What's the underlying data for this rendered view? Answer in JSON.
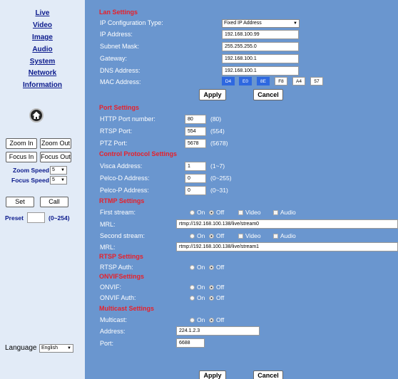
{
  "nav": {
    "live": "Live",
    "video": "Video",
    "image": "Image",
    "audio": "Audio",
    "system": "System",
    "network": "Network",
    "information": "Information"
  },
  "ptz": {
    "zoom_in": "Zoom In",
    "zoom_out": "Zoom Out",
    "focus_in": "Focus In",
    "focus_out": "Focus Out",
    "zoom_speed_label": "Zoom Speed",
    "zoom_speed_value": "5",
    "focus_speed_label": "Focus Speed",
    "focus_speed_value": "5",
    "set": "Set",
    "call": "Call",
    "preset_label": "Preset",
    "preset_value": "",
    "preset_range": "(0~254)"
  },
  "language": {
    "label": "Language",
    "value": "English"
  },
  "lan": {
    "title": "Lan Settings",
    "ip_type_label": "IP Configuration Type:",
    "ip_type_value": "Fixed IP Address",
    "ip_label": "IP Address:",
    "ip_value": "192.168.100.99",
    "subnet_label": "Subnet Mask:",
    "subnet_value": "255.255.255.0",
    "gateway_label": "Gateway:",
    "gateway_value": "192.168.100.1",
    "dns_label": "DNS Address:",
    "dns_value": "192.168.100.1",
    "mac_label": "MAC Address:",
    "mac": [
      "D4",
      "E0",
      "8E",
      "F8",
      "A4",
      "57"
    ]
  },
  "buttons": {
    "apply": "Apply",
    "cancel": "Cancel"
  },
  "port": {
    "title": "Port Settings",
    "http_label": "HTTP Port number:",
    "http_value": "80",
    "http_hint": "(80)",
    "rtsp_label": "RTSP Port:",
    "rtsp_value": "554",
    "rtsp_hint": "(554)",
    "ptz_label": "PTZ Port:",
    "ptz_value": "5678",
    "ptz_hint": "(5678)"
  },
  "control": {
    "title": "Control Protocol Settings",
    "visca_label": "Visca Address:",
    "visca_value": "1",
    "visca_hint": "(1~7)",
    "pelcod_label": "Pelco-D Address:",
    "pelcod_value": "0",
    "pelcod_hint": "(0~255)",
    "pelcop_label": "Pelco-P Address:",
    "pelcop_value": "0",
    "pelcop_hint": "(0~31)"
  },
  "rtmp": {
    "title": "RTMP Settings",
    "first_label": "First stream:",
    "mrl_label": "MRL:",
    "first_mrl": "rtmp://192.168.100.138/live/stream0",
    "second_label": "Second stream:",
    "second_mrl": "rtmp://192.168.100.138/live/stream1",
    "on": "On",
    "off": "Off",
    "video": "Video",
    "audio": "Audio"
  },
  "rtsp": {
    "title": "RTSP Settings",
    "auth_label": "RTSP Auth:"
  },
  "onvif": {
    "title": "ONVIFSettings",
    "onvif_label": "ONVIF:",
    "auth_label": "ONVIF Auth:"
  },
  "multicast": {
    "title": "Multicast Settings",
    "multicast_label": "Multicast:",
    "address_label": "Address:",
    "address_value": "224.1.2.3",
    "port_label": "Port:",
    "port_value": "6688"
  }
}
